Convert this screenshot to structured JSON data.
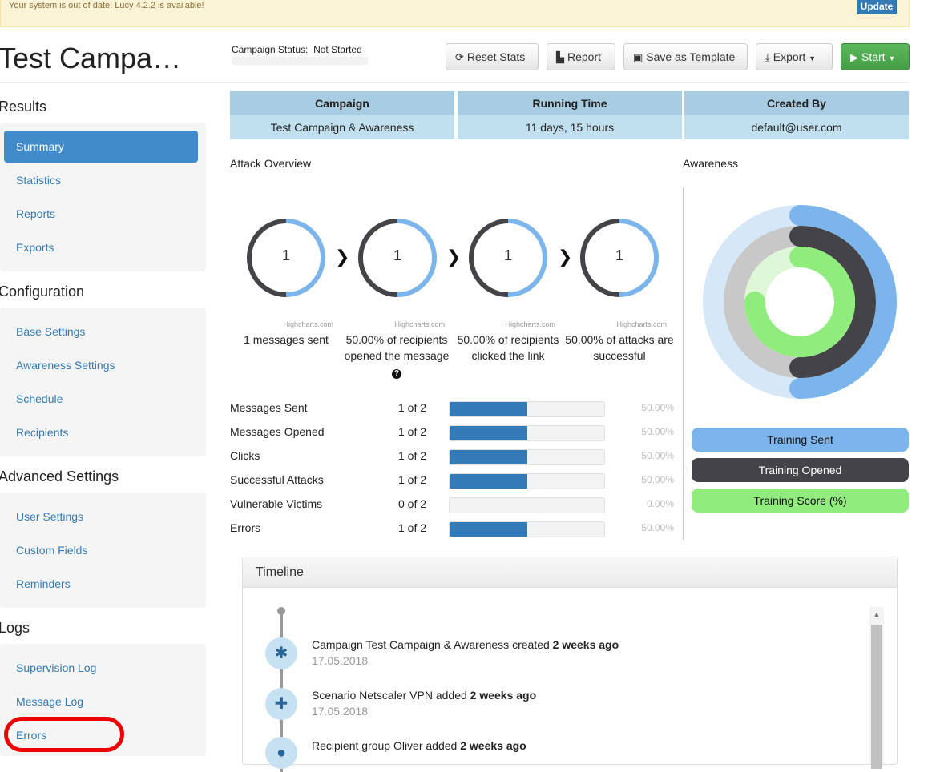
{
  "banner": {
    "text": "Your system is out of date! Lucy 4.2.2 is available!",
    "update_label": "Update"
  },
  "page_title": "Test Campa…",
  "campaign_status": {
    "label": "Campaign Status:",
    "value": "Not Started"
  },
  "toolbar": {
    "reset_stats": "Reset Stats",
    "report": "Report",
    "save_template": "Save as Template",
    "export": "Export",
    "start": "Start"
  },
  "sidebar": {
    "sections": [
      {
        "title": "Results",
        "items": [
          "Summary",
          "Statistics",
          "Reports",
          "Exports"
        ]
      },
      {
        "title": "Configuration",
        "items": [
          "Base Settings",
          "Awareness Settings",
          "Schedule",
          "Recipients"
        ]
      },
      {
        "title": "Advanced Settings",
        "items": [
          "User Settings",
          "Custom Fields",
          "Reminders"
        ]
      },
      {
        "title": "Logs",
        "items": [
          "Supervision Log",
          "Message Log",
          "Errors"
        ]
      }
    ],
    "active_item": "Summary"
  },
  "info_table": {
    "headers": [
      "Campaign",
      "Running Time",
      "Created By"
    ],
    "values": [
      "Test Campaign & Awareness",
      "11 days, 15 hours",
      "default@user.com"
    ]
  },
  "attack_overview": {
    "title": "Attack Overview",
    "credit": "Highcharts.com",
    "donuts": [
      {
        "value": "1",
        "fraction": 0.5,
        "caption": "1 messages sent"
      },
      {
        "value": "1",
        "fraction": 0.5,
        "caption": "50.00% of recipients opened the message"
      },
      {
        "value": "1",
        "fraction": 0.5,
        "caption": "50.00% of recipients clicked the link"
      },
      {
        "value": "1",
        "fraction": 0.5,
        "caption": "50.00% of attacks are successful"
      }
    ]
  },
  "stats": [
    {
      "name": "Messages Sent",
      "count": "1 of 2",
      "pct": "50.00%",
      "fraction": 0.5
    },
    {
      "name": "Messages Opened",
      "count": "1 of 2",
      "pct": "50.00%",
      "fraction": 0.5
    },
    {
      "name": "Clicks",
      "count": "1 of 2",
      "pct": "50.00%",
      "fraction": 0.5
    },
    {
      "name": "Successful Attacks",
      "count": "1 of 2",
      "pct": "50.00%",
      "fraction": 0.5
    },
    {
      "name": "Vulnerable Victims",
      "count": "0 of 2",
      "pct": "0.00%",
      "fraction": 0
    },
    {
      "name": "Errors",
      "count": "1 of 2",
      "pct": "50.00%",
      "fraction": 0.5
    }
  ],
  "awareness": {
    "title": "Awareness",
    "rings": [
      {
        "name": "Training Sent",
        "fraction": 0.5,
        "color": "#7cb5ec",
        "track": "#d6e8f8"
      },
      {
        "name": "Training Opened",
        "fraction": 0.5,
        "color": "#434348",
        "track": "#c8c8c8"
      },
      {
        "name": "Training Score (%)",
        "fraction": 0.75,
        "color": "#90ed7d",
        "track": "#def7d9"
      }
    ]
  },
  "timeline": {
    "title": "Timeline",
    "events": [
      {
        "icon": "asterisk-icon",
        "glyph": "✱",
        "text": "Campaign Test Campaign & Awareness created",
        "ago": "2 weeks ago",
        "date": "17.05.2018"
      },
      {
        "icon": "plus-icon",
        "glyph": "✚",
        "text": "Scenario Netscaler VPN added",
        "ago": "2 weeks ago",
        "date": "17.05.2018"
      },
      {
        "icon": "user-icon",
        "glyph": "●",
        "text": "Recipient group Oliver added",
        "ago": "2 weeks ago",
        "date": ""
      }
    ]
  }
}
